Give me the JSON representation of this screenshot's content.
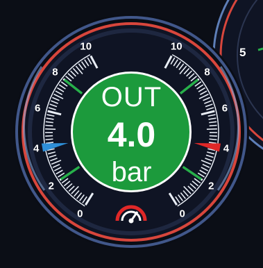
{
  "gauge": {
    "direction_label": "OUT",
    "value": "4.0",
    "value_number": 4.0,
    "unit": "bar",
    "range": [
      0,
      10
    ],
    "left_scale_labels": [
      "0",
      "2",
      "4",
      "6",
      "8",
      "10"
    ],
    "right_scale_labels": [
      "0",
      "2",
      "4",
      "6",
      "8",
      "10"
    ],
    "left_marker_value": 4.0,
    "right_marker_value": 4.0,
    "green_tick_values": [
      2,
      8
    ],
    "icon": "speedometer-icon"
  },
  "neighbor_gauge": {
    "label": "5"
  },
  "colors": {
    "background": "#0b0e16",
    "dial_face": "#0f1424",
    "center_fill": "#1c9a3c",
    "outer_ring_red": "#d8463c",
    "outer_ring_blue": "#5e7fb8",
    "left_marker": "#2e8fd8",
    "right_marker": "#e02828",
    "green_tick": "#27b04a",
    "scale_white": "#e9eef6"
  }
}
